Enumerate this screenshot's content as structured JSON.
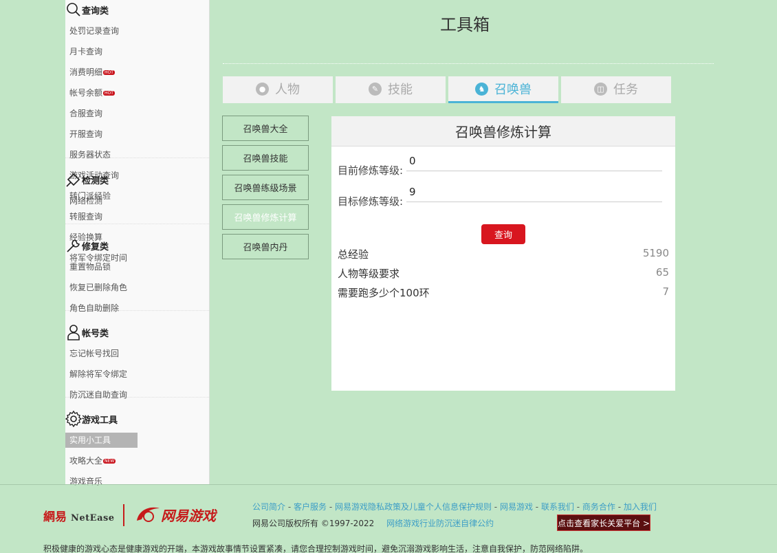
{
  "sidebar": {
    "categories": [
      {
        "title": "查询类",
        "icon": "search-icon",
        "links": [
          {
            "label": "处罚记录查询"
          },
          {
            "label": "月卡查询"
          },
          {
            "label": "消费明细",
            "badge": "HOT"
          },
          {
            "label": "帐号余额",
            "badge": "HOT"
          },
          {
            "label": "合服查询"
          },
          {
            "label": "开服查询"
          },
          {
            "label": "服务器状态"
          },
          {
            "label": "游戏活动查询"
          },
          {
            "label": "转门派经验"
          },
          {
            "label": "转服查询"
          },
          {
            "label": "经验换算"
          },
          {
            "label": "将军令绑定时间"
          }
        ]
      },
      {
        "title": "检测类",
        "icon": "pin-icon",
        "links": [
          {
            "label": "网络检测"
          }
        ]
      },
      {
        "title": "修复类",
        "icon": "wrench-icon",
        "links": [
          {
            "label": "重置物品锁"
          },
          {
            "label": "恢复已删除角色"
          },
          {
            "label": "角色自助删除"
          }
        ]
      },
      {
        "title": "帐号类",
        "icon": "user-icon",
        "links": [
          {
            "label": "忘记帐号找回"
          },
          {
            "label": "解除将军令绑定"
          },
          {
            "label": "防沉迷自助查询"
          }
        ]
      },
      {
        "title": "游戏工具",
        "icon": "gear-icon",
        "links": [
          {
            "label": "实用小工具",
            "active": true
          },
          {
            "label": "攻略大全",
            "badge": "NEW"
          },
          {
            "label": "游戏音乐"
          }
        ]
      }
    ]
  },
  "page_title": "工具箱",
  "tabs": [
    {
      "label": "人物",
      "icon": "person-icon"
    },
    {
      "label": "技能",
      "icon": "skill-icon"
    },
    {
      "label": "召唤兽",
      "icon": "pet-icon",
      "active": true
    },
    {
      "label": "任务",
      "icon": "book-icon"
    }
  ],
  "subnav": [
    {
      "label": "召唤兽大全"
    },
    {
      "label": "召唤兽技能"
    },
    {
      "label": "召唤兽练级场景"
    },
    {
      "label": "召唤兽修炼计算",
      "active": true
    },
    {
      "label": "召唤兽内丹"
    }
  ],
  "panel": {
    "title": "召唤兽修炼计算",
    "current_label": "目前修炼等级:",
    "current_value": "0",
    "target_label": "目标修炼等级:",
    "target_value": "9",
    "query_label": "查询",
    "results": [
      {
        "label": "总经验",
        "value": "5190"
      },
      {
        "label": "人物等级要求",
        "value": "65"
      },
      {
        "label": "需要跑多少个100环",
        "value": "7"
      }
    ]
  },
  "footer": {
    "logo_cn": "網易",
    "logo_en": "NetEase",
    "logo_games": "网易游戏",
    "links": [
      "公司简介",
      "客户服务",
      "网易游戏隐私政策及儿童个人信息保护规则",
      "网易游戏",
      "联系我们",
      "商务合作",
      "加入我们"
    ],
    "copyright": "网易公司版权所有 ©1997-2022",
    "convention": "网络游戏行业防沉迷自律公约",
    "parent_button": "点击查看家长关爱平台 >",
    "notice": "积极健康的游戏心态是健康游戏的开端，本游戏故事情节设置紧凑，请您合理控制游戏时间，避免沉溺游戏影响生活，注意自我保护，防范网络陷阱。"
  },
  "colors": {
    "background": "#c2e6c6",
    "accent": "#4ab3d6",
    "query_button": "#d8161f"
  }
}
